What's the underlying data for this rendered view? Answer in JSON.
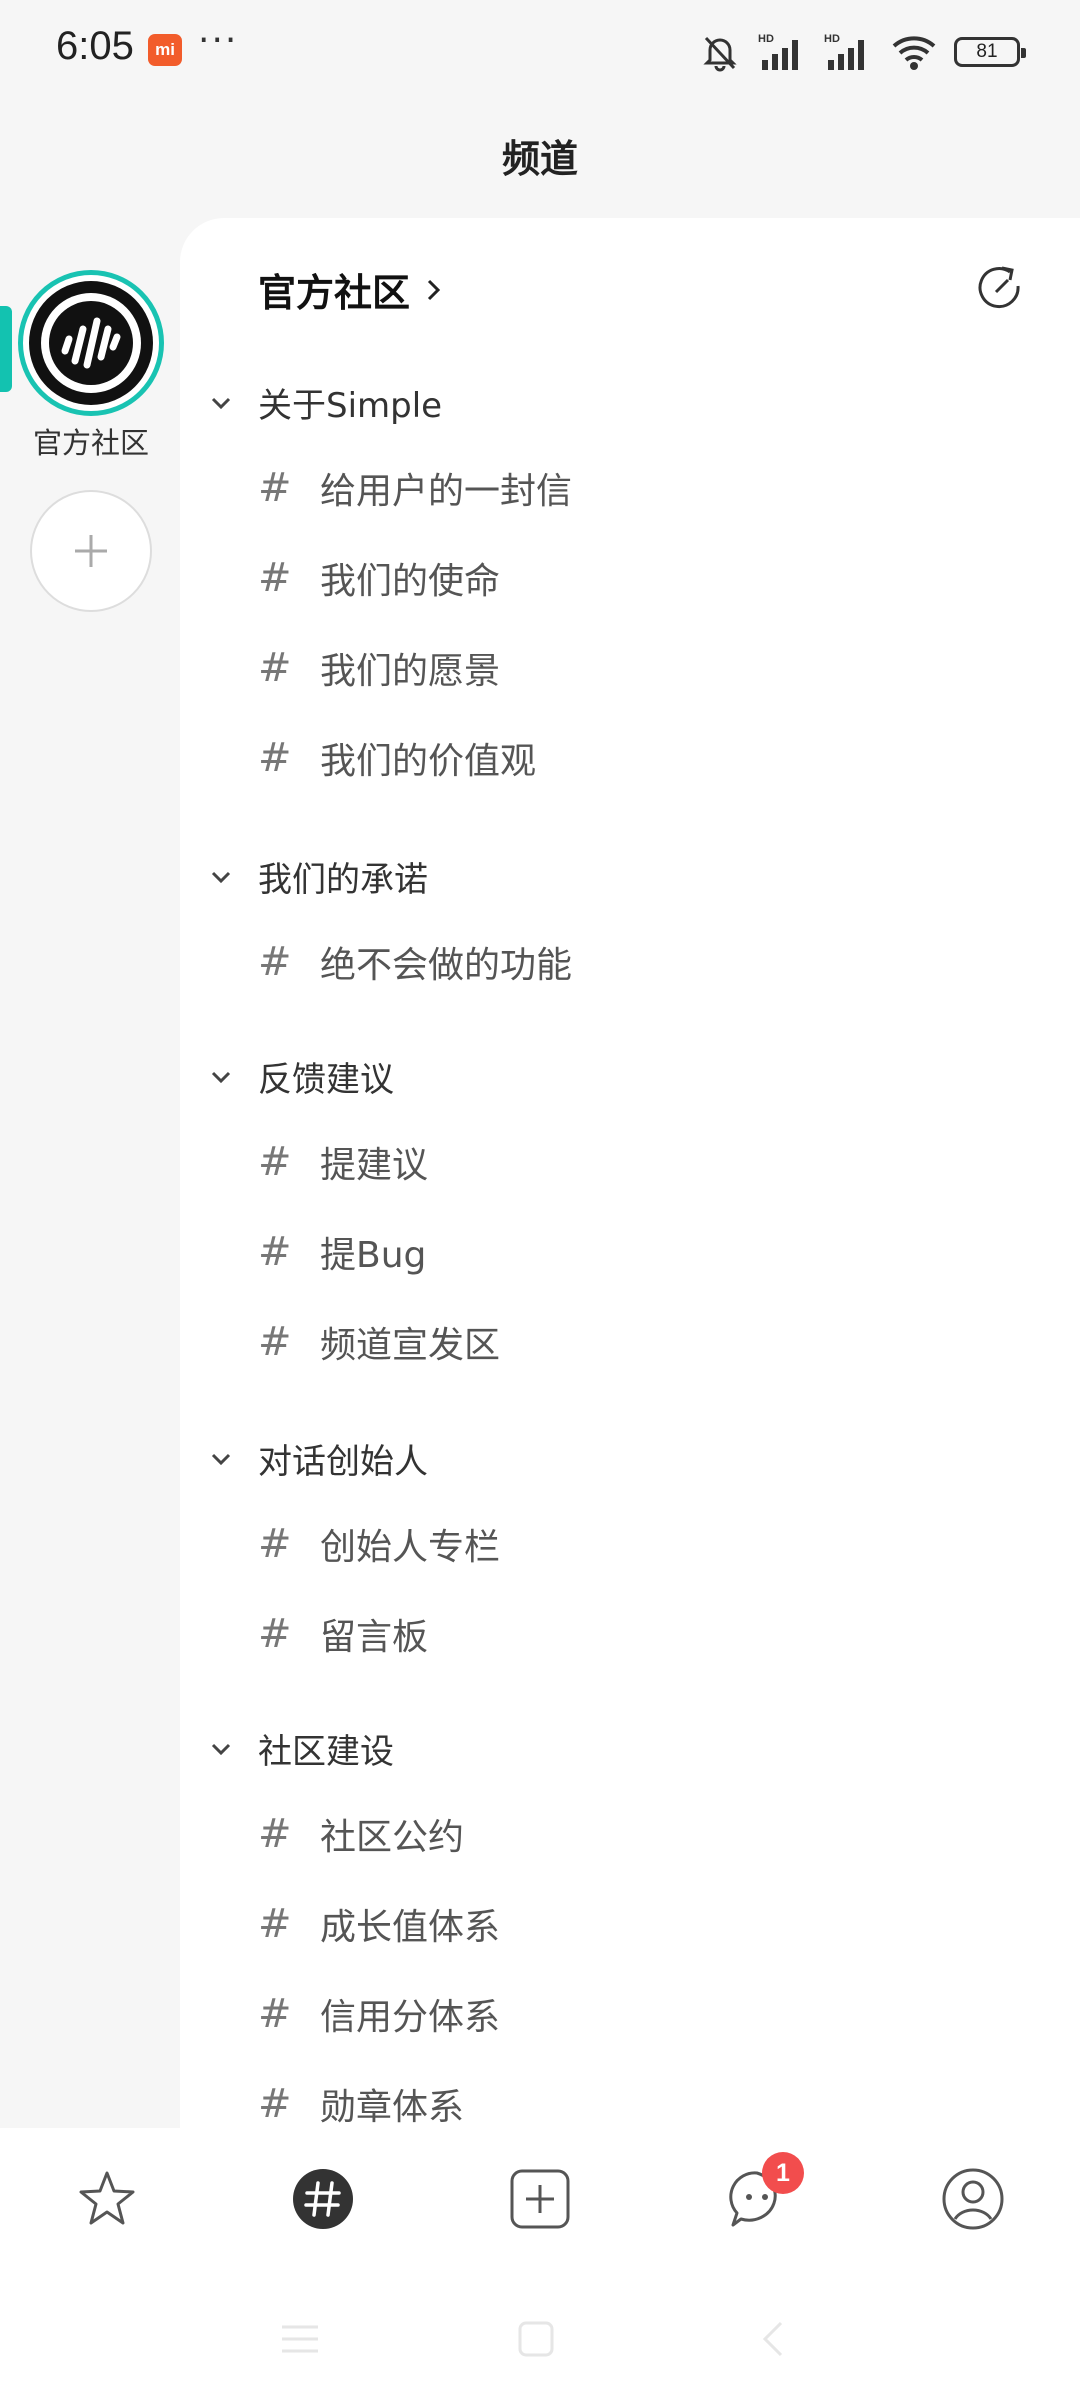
{
  "status_bar": {
    "time": "6:05",
    "mi_badge": "mi",
    "dots": "···",
    "battery": "81",
    "icons": [
      "bell-off-icon",
      "hd-signal-icon",
      "hd-signal-icon",
      "wifi-icon",
      "battery-icon"
    ]
  },
  "page_title": "频道",
  "sidebar": {
    "servers": [
      {
        "label": "官方社区",
        "selected": true,
        "icon": "waveform-logo-icon"
      }
    ],
    "add_icon": "plus-icon"
  },
  "panel": {
    "title": "官方社区",
    "title_icon": "chevron-right-icon",
    "refresh_icon": "refresh-icon",
    "categories": [
      {
        "label": "关于Simple",
        "channels": [
          "给用户的一封信",
          "我们的使命",
          "我们的愿景",
          "我们的价值观"
        ]
      },
      {
        "label": "我们的承诺",
        "channels": [
          "绝不会做的功能"
        ]
      },
      {
        "label": "反馈建议",
        "channels": [
          "提建议",
          "提Bug",
          "频道宣发区"
        ]
      },
      {
        "label": "对话创始人",
        "channels": [
          "创始人专栏",
          "留言板"
        ]
      },
      {
        "label": "社区建设",
        "channels": [
          "社区公约",
          "成长值体系",
          "信用分体系",
          "勋章体系"
        ]
      }
    ],
    "hash_symbol": "#"
  },
  "bottom_nav": {
    "items": [
      {
        "name": "star-icon",
        "active": false
      },
      {
        "name": "hash-icon",
        "active": true
      },
      {
        "name": "add-square-icon",
        "active": false
      },
      {
        "name": "chat-icon",
        "active": false,
        "badge": "1"
      },
      {
        "name": "profile-icon",
        "active": false
      }
    ]
  },
  "colors": {
    "accent": "#13c2b0",
    "badge": "#f24d4d",
    "mi": "#f25c2b"
  }
}
